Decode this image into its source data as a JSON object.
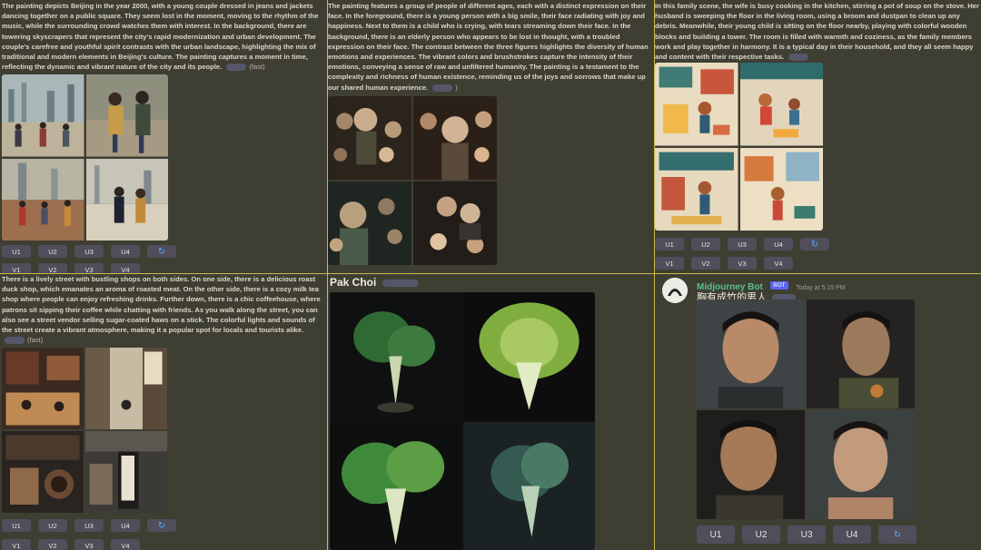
{
  "panels": {
    "beijing": {
      "text": "The painting depicts Beijing in the year 2000, with a young couple dressed in jeans and jackets dancing together on a public square. They seem lost in the moment, moving to the rhythm of the music, while the surrounding crowd watches them with interest. In the background, there are towering skyscrapers that represent the city's rapid modernization and urban development. The couple's carefree and youthful spirit contrasts with the urban landscape, highlighting the mix of traditional and modern elements in Beijing's culture. The painting captures a moment in time, reflecting the dynamic and vibrant nature of the city and its people.",
      "tag": "(fast)",
      "upscale_buttons": [
        "U1",
        "U2",
        "U3",
        "U4"
      ],
      "variation_buttons": [
        "V1",
        "V2",
        "V3",
        "V4"
      ]
    },
    "faces": {
      "text": "The painting features a group of people of different ages, each with a distinct expression on their face. In the foreground, there is a young person with a big smile, their face radiating with joy and happiness. Next to them is a child who is crying, with tears streaming down their face. In the background, there is an elderly person who appears to be lost in thought, with a troubled expression on their face. The contrast between the three figures highlights the diversity of human emotions and experiences. The vibrant colors and brushstrokes capture the intensity of their emotions, conveying a sense of raw and unfiltered humanity. The painting is a testament to the complexity and richness of human existence, reminding us of the joys and sorrows that make up our shared human experience.",
      "tag": ")"
    },
    "family": {
      "text": "In this family scene, the wife is busy cooking in the kitchen, stirring a pot of soup on the stove. Her husband is sweeping the floor in the living room, using a broom and dustpan to clean up any debris. Meanwhile, their young child is sitting on the floor nearby, playing with colorful wooden blocks and building a tower. The room is filled with warmth and coziness, as the family members work and play together in harmony. It is a typical day in their household, and they all seem happy and content with their respective tasks.",
      "upscale_buttons": [
        "U1",
        "U2",
        "U3",
        "U4"
      ],
      "variation_buttons": [
        "V1",
        "V2",
        "V3",
        "V4"
      ]
    },
    "street": {
      "text": "There is a lively street with bustling shops on both sides. On one side, there is a delicious roast duck shop, which emanates an aroma of roasted meat. On the other side, there is a cozy milk tea shop where people can enjoy refreshing drinks. Further down, there is a chic coffeehouse, where patrons sit sipping their coffee while chatting with friends. As you walk along the street, you can also see a street vendor selling sugar-coated haws on a stick. The colorful lights and sounds of the street create a vibrant atmosphere, making it a popular spot for locals and tourists alike.",
      "tag": "(fast)",
      "upscale_buttons": [
        "U1",
        "U2",
        "U3",
        "U4"
      ],
      "variation_buttons": [
        "V1",
        "V2",
        "V3",
        "V4"
      ]
    },
    "pakchoi": {
      "title": "Pak Choi"
    },
    "portrait": {
      "bot_name": "Midjourney Bot",
      "badge": "BOT",
      "time": "Today at 5:15 PM",
      "prompt": "胸有成竹的男人",
      "upscale_buttons": [
        "U1",
        "U2",
        "U3",
        "U4"
      ]
    }
  },
  "colors": {
    "background": "#3f3e33",
    "divider": "#c9b94a",
    "button": "#4f4e5a",
    "refresh": "#5aa9ff",
    "bot_name": "#56c08a"
  }
}
